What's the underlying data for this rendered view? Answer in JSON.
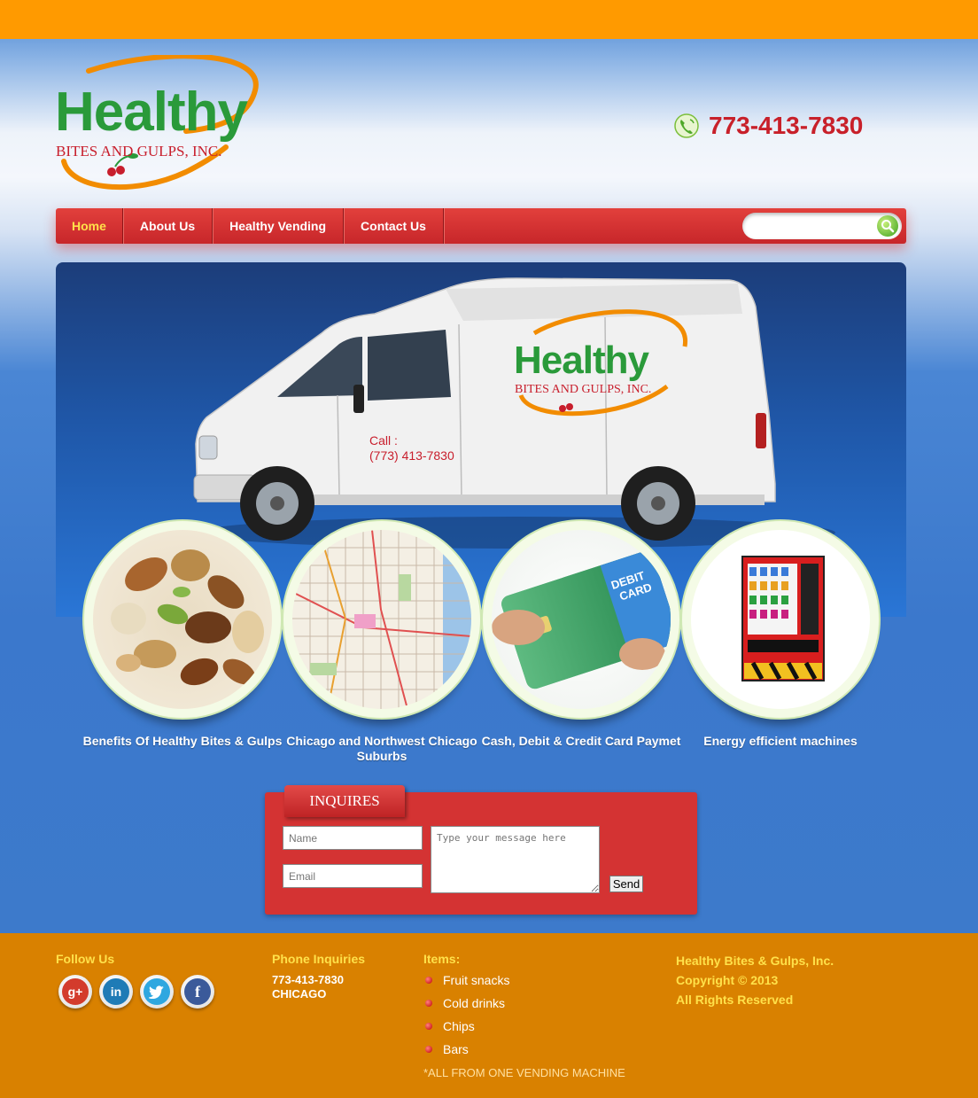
{
  "brand": {
    "logo_word": "Healthy",
    "logo_sub": "BITES AND GULPS, INC.",
    "phone": "773-413-7830"
  },
  "nav": {
    "items": [
      {
        "label": "Home",
        "active": true
      },
      {
        "label": "About Us",
        "active": false
      },
      {
        "label": "Healthy Vending",
        "active": false
      },
      {
        "label": "Contact Us",
        "active": false
      }
    ],
    "search": {
      "value": "",
      "placeholder": ""
    }
  },
  "hero": {
    "van_logo_word": "Healthy",
    "van_logo_sub": "BITES AND GULPS, INC.",
    "van_call_label": "Call :",
    "van_call_number": "(773) 413-7830",
    "card_text": "DEBIT CARD"
  },
  "features": [
    {
      "caption": "Benefits Of Healthy Bites & Gulps",
      "image": "mixed-nuts"
    },
    {
      "caption": "Chicago and Northwest Chicago Suburbs",
      "image": "chicago-map"
    },
    {
      "caption": "Cash, Debit & Credit Card Paymet",
      "image": "debit-card"
    },
    {
      "caption": "Energy efficient machines",
      "image": "vending-machine"
    }
  ],
  "inquires": {
    "title": "INQUIRES",
    "name_placeholder": "Name",
    "email_placeholder": "Email",
    "message_placeholder": "Type your message here",
    "send_label": "Send"
  },
  "footer": {
    "follow_title": "Follow Us",
    "social": [
      "google-plus-icon",
      "linkedin-icon",
      "twitter-icon",
      "facebook-icon"
    ],
    "phone_title": "Phone Inquiries",
    "phone_number": "773-413-7830",
    "phone_city": "CHICAGO",
    "items_title": "Items:",
    "items": [
      "Fruit snacks",
      "Cold drinks",
      "Chips",
      "Bars"
    ],
    "items_note": "*ALL FROM ONE VENDING MACHINE",
    "company": "Healthy Bites & Gulps, Inc.",
    "copyright": "Copyright © 2013",
    "rights": "All Rights Reserved"
  },
  "colors": {
    "top_bar": "#ff9a00",
    "nav_red": "#d43333",
    "brand_green": "#2a9a3a",
    "brand_red": "#c81e2c",
    "footer": "#d98100",
    "footer_heading": "#ffe14a"
  }
}
